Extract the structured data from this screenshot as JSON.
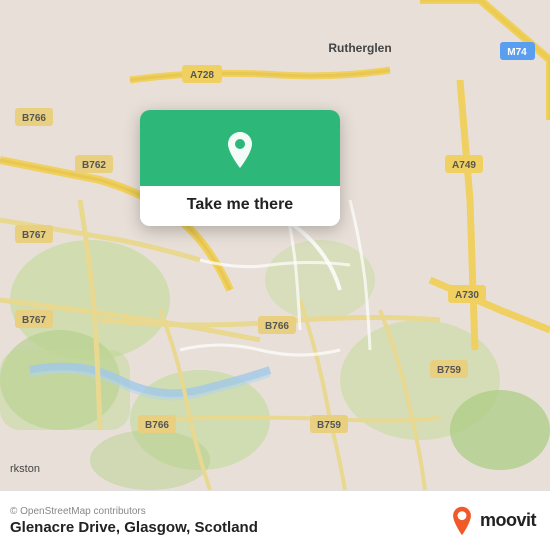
{
  "map": {
    "attribution": "© OpenStreetMap contributors",
    "center_location": "Glasgow, Scotland",
    "background_color": "#e8e0d8"
  },
  "popup": {
    "button_label": "Take me there",
    "pin_color": "#ffffff",
    "background_color": "#2db87a"
  },
  "bottom_bar": {
    "attribution": "© OpenStreetMap contributors",
    "location_name": "Glenacre Drive, Glasgow, Scotland",
    "moovit_label": "moovit"
  },
  "road_labels": [
    {
      "id": "r1",
      "label": "A728"
    },
    {
      "id": "r2",
      "label": "B766"
    },
    {
      "id": "r3",
      "label": "B762"
    },
    {
      "id": "r4",
      "label": "B767"
    },
    {
      "id": "r5",
      "label": "B767"
    },
    {
      "id": "r6",
      "label": "B766"
    },
    {
      "id": "r7",
      "label": "B766"
    },
    {
      "id": "r8",
      "label": "B759"
    },
    {
      "id": "r9",
      "label": "B759"
    },
    {
      "id": "r10",
      "label": "A749"
    },
    {
      "id": "r11",
      "label": "A730"
    },
    {
      "id": "r12",
      "label": "M74"
    },
    {
      "id": "r13",
      "label": "Rutherglen"
    },
    {
      "id": "r14",
      "label": "rkston"
    }
  ]
}
